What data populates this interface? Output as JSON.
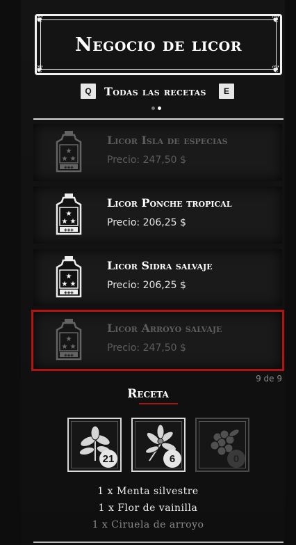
{
  "header": {
    "title": "Negocio de licor"
  },
  "tabs": {
    "prev_key": "Q",
    "next_key": "E",
    "label": "Todas las recetas",
    "page_dots": 2,
    "active_dot": 1
  },
  "items": [
    {
      "name": "Licor Isla de especias",
      "price": "Precio: 247,50 $",
      "state": "dim",
      "icon": "liquor-bottle-icon"
    },
    {
      "name": "Licor Ponche tropical",
      "price": "Precio: 206,25 $",
      "state": "normal",
      "icon": "liquor-bottle-icon"
    },
    {
      "name": "Licor Sidra salvaje",
      "price": "Precio: 206,25 $",
      "state": "normal",
      "icon": "liquor-bottle-icon"
    },
    {
      "name": "Licor Arroyo salvaje",
      "price": "Precio: 247,50 $",
      "state": "dim-selected",
      "icon": "liquor-bottle-icon"
    }
  ],
  "counter": "9 de 9",
  "recipe": {
    "title": "Receta",
    "ingredients": [
      {
        "icon": "wild-mint-icon",
        "count": "21",
        "line": "1 x Menta silvestre",
        "available": true
      },
      {
        "icon": "vanilla-flower-icon",
        "count": "6",
        "line": "1 x Flor de vainilla",
        "available": true
      },
      {
        "icon": "creek-plum-icon",
        "count": "0",
        "line": "1 x Ciruela de arroyo",
        "available": false
      }
    ]
  },
  "colors": {
    "selection": "#b31313",
    "background": "#0d0d0d",
    "text": "#ffffff"
  }
}
